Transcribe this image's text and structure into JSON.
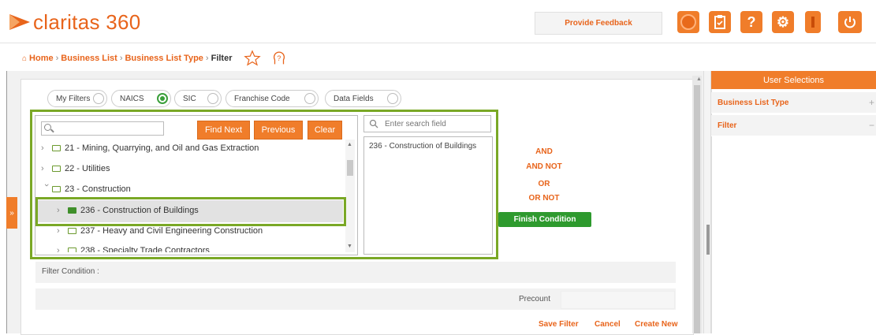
{
  "app": {
    "name": "claritas 360",
    "brand_color": "#e8641b",
    "accent_green": "#7aa826"
  },
  "header": {
    "feedback_label": "Provide Feedback",
    "icons": [
      "circle-icon",
      "clipboard-icon",
      "help-icon",
      "gear-icon",
      "info-icon",
      "power-icon"
    ]
  },
  "breadcrumb": {
    "items": [
      "Home",
      "Business List",
      "Business List Type"
    ],
    "current": "Filter",
    "separator": "›"
  },
  "tabs": [
    {
      "label": "My Filters",
      "selected": false
    },
    {
      "label": "NAICS",
      "selected": true
    },
    {
      "label": "SIC",
      "selected": false
    },
    {
      "label": "Franchise Code",
      "selected": false
    },
    {
      "label": "Data Fields",
      "selected": false
    }
  ],
  "tree": {
    "search_value": "",
    "buttons": {
      "find_next": "Find Next",
      "previous": "Previous",
      "clear": "Clear"
    },
    "rows": [
      {
        "label": "21 - Mining, Quarrying, and Oil and Gas Extraction",
        "expanded": false
      },
      {
        "label": "22 - Utilities",
        "expanded": false
      },
      {
        "label": "23 - Construction",
        "expanded": true
      },
      {
        "label": "236 - Construction of Buildings",
        "selected": true
      },
      {
        "label": "237 - Heavy and Civil Engineering Construction",
        "selected": false
      },
      {
        "label": "238 - Specialty Trade Contractors",
        "selected": false
      }
    ]
  },
  "field_search": {
    "placeholder": "Enter search field",
    "selected_item": "236 - Construction of Buildings"
  },
  "operators": [
    "AND",
    "AND NOT",
    "OR",
    "OR NOT"
  ],
  "finish_label": "Finish Condition",
  "filter_condition_label": "Filter Condition :",
  "precount_label": "Precount",
  "footer_links": {
    "save": "Save Filter",
    "cancel": "Cancel",
    "create": "Create New"
  },
  "user_selections": {
    "title": "User Selections",
    "rows": [
      {
        "label": "Business List Type",
        "sign": "+"
      },
      {
        "label": "Filter",
        "sign": "−"
      }
    ]
  }
}
